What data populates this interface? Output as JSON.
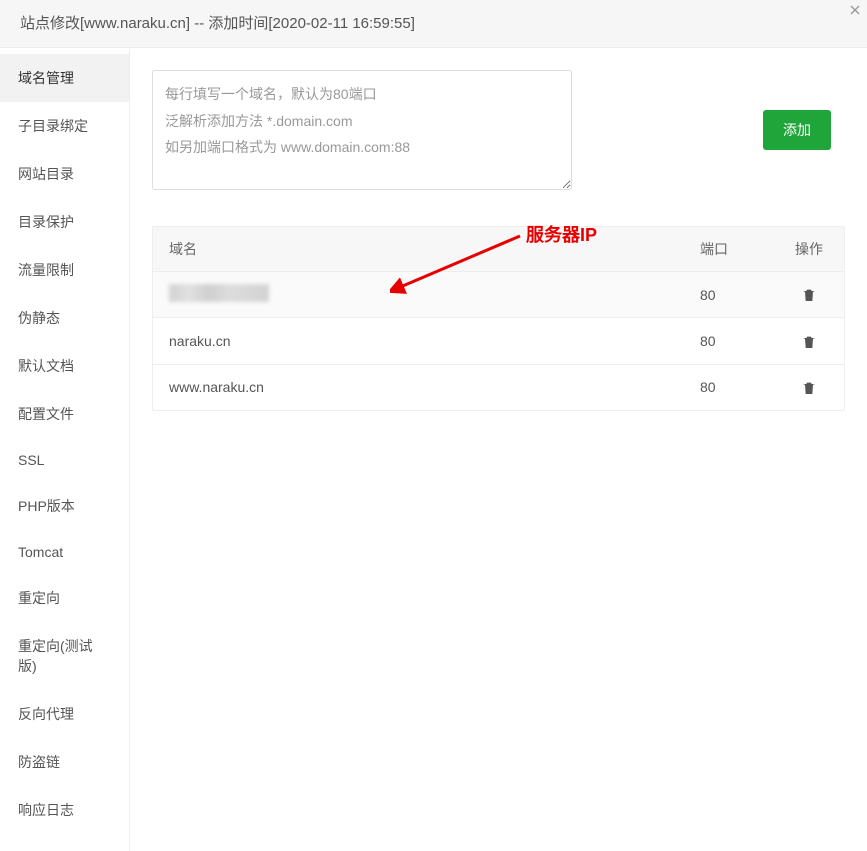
{
  "header": {
    "title": "站点修改[www.naraku.cn] -- 添加时间[2020-02-11 16:59:55]"
  },
  "sidebar": {
    "items": [
      {
        "label": "域名管理"
      },
      {
        "label": "子目录绑定"
      },
      {
        "label": "网站目录"
      },
      {
        "label": "目录保护"
      },
      {
        "label": "流量限制"
      },
      {
        "label": "伪静态"
      },
      {
        "label": "默认文档"
      },
      {
        "label": "配置文件"
      },
      {
        "label": "SSL"
      },
      {
        "label": "PHP版本"
      },
      {
        "label": "Tomcat"
      },
      {
        "label": "重定向"
      },
      {
        "label": "重定向(测试版)"
      },
      {
        "label": "反向代理"
      },
      {
        "label": "防盗链"
      },
      {
        "label": "响应日志"
      }
    ],
    "active_index": 0
  },
  "main": {
    "textarea_placeholder": "每行填写一个域名，默认为80端口\n泛解析添加方法 *.domain.com\n如另加端口格式为 www.domain.com:88",
    "add_button": "添加",
    "annotation_label": "服务器IP",
    "table": {
      "headers": {
        "domain": "域名",
        "port": "端口",
        "action": "操作"
      },
      "rows": [
        {
          "domain": "",
          "port": "80",
          "blurred": true
        },
        {
          "domain": "naraku.cn",
          "port": "80",
          "blurred": false
        },
        {
          "domain": "www.naraku.cn",
          "port": "80",
          "blurred": false
        }
      ]
    }
  }
}
